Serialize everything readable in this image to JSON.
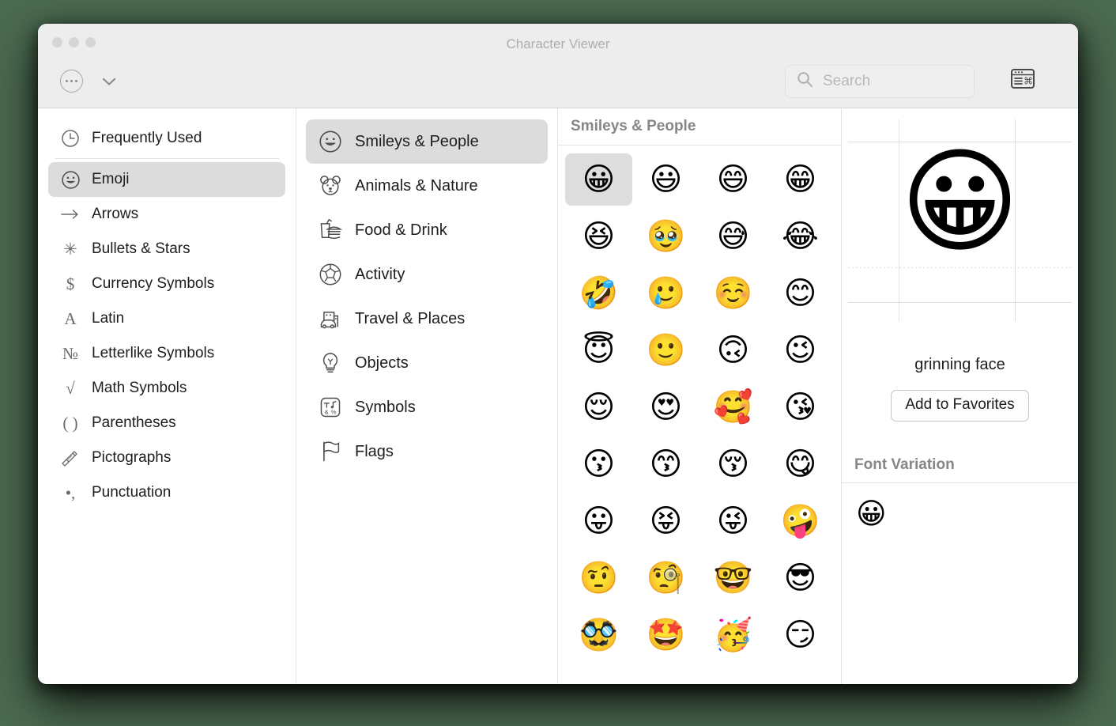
{
  "window": {
    "title": "Character Viewer",
    "traffic_lights": [
      "close",
      "minimize",
      "zoom"
    ]
  },
  "toolbar": {
    "ellipsis_icon": "ellipsis-circle-icon",
    "chevron_icon": "chevron-down-icon",
    "search": {
      "placeholder": "Search",
      "value": "",
      "icon": "search-icon"
    },
    "keyboard_viewer_icon": "keyboard-viewer-icon"
  },
  "sidebar": {
    "items": [
      {
        "label": "Frequently Used",
        "icon": "clock-icon",
        "glyph": "",
        "selected": false
      },
      {
        "label": "Emoji",
        "icon": "smiley-outline-icon",
        "glyph": "",
        "selected": true
      },
      {
        "label": "Arrows",
        "icon": "arrow-right-icon",
        "glyph": "⟶",
        "selected": false
      },
      {
        "label": "Bullets & Stars",
        "icon": "starburst-icon",
        "glyph": "✳",
        "selected": false
      },
      {
        "label": "Currency Symbols",
        "icon": "dollar-sign-icon",
        "glyph": "$",
        "selected": false
      },
      {
        "label": "Latin",
        "icon": "letter-a-icon",
        "glyph": "A",
        "selected": false
      },
      {
        "label": "Letterlike Symbols",
        "icon": "numero-sign-icon",
        "glyph": "№",
        "selected": false
      },
      {
        "label": "Math Symbols",
        "icon": "square-root-icon",
        "glyph": "√",
        "selected": false
      },
      {
        "label": "Parentheses",
        "icon": "parentheses-icon",
        "glyph": "( )",
        "selected": false
      },
      {
        "label": "Pictographs",
        "icon": "writing-hand-icon",
        "glyph": "",
        "selected": false
      },
      {
        "label": "Punctuation",
        "icon": "comma-dot-icon",
        "glyph": "•,",
        "selected": false
      }
    ],
    "separator_after_index": 0
  },
  "categories": {
    "items": [
      {
        "label": "Smileys & People",
        "icon": "smiley-outline-icon",
        "selected": true
      },
      {
        "label": "Animals & Nature",
        "icon": "bear-face-icon",
        "selected": false
      },
      {
        "label": "Food & Drink",
        "icon": "burger-drink-icon",
        "selected": false
      },
      {
        "label": "Activity",
        "icon": "soccer-ball-icon",
        "selected": false
      },
      {
        "label": "Travel & Places",
        "icon": "car-building-icon",
        "selected": false
      },
      {
        "label": "Objects",
        "icon": "lightbulb-icon",
        "selected": false
      },
      {
        "label": "Symbols",
        "icon": "symbols-box-icon",
        "selected": false
      },
      {
        "label": "Flags",
        "icon": "flag-icon",
        "selected": false
      }
    ]
  },
  "grid": {
    "header": "Smileys & People",
    "columns": 4,
    "selected_index": 0,
    "emojis": [
      "😀",
      "😃",
      "😄",
      "😁",
      "😆",
      "🥹",
      "😅",
      "😂",
      "🤣",
      "🥲",
      "☺️",
      "😊",
      "😇",
      "🙂",
      "🙃",
      "😉",
      "😌",
      "😍",
      "🥰",
      "😘",
      "😗",
      "😙",
      "😚",
      "😋",
      "😛",
      "😝",
      "😜",
      "🤪",
      "🤨",
      "🧐",
      "🤓",
      "😎",
      "🥸",
      "🤩",
      "🥳",
      "😏"
    ]
  },
  "detail": {
    "preview_glyph": "😀",
    "character_name": "grinning face",
    "add_to_favorites_label": "Add to Favorites",
    "font_variation_header": "Font Variation",
    "font_variations": [
      "😀"
    ]
  },
  "colors": {
    "desktop": "#4c6b51",
    "titlebar": "#ededed",
    "selection": "#dcdcdc",
    "header_text": "#868686",
    "title_text": "#aeaeae"
  }
}
